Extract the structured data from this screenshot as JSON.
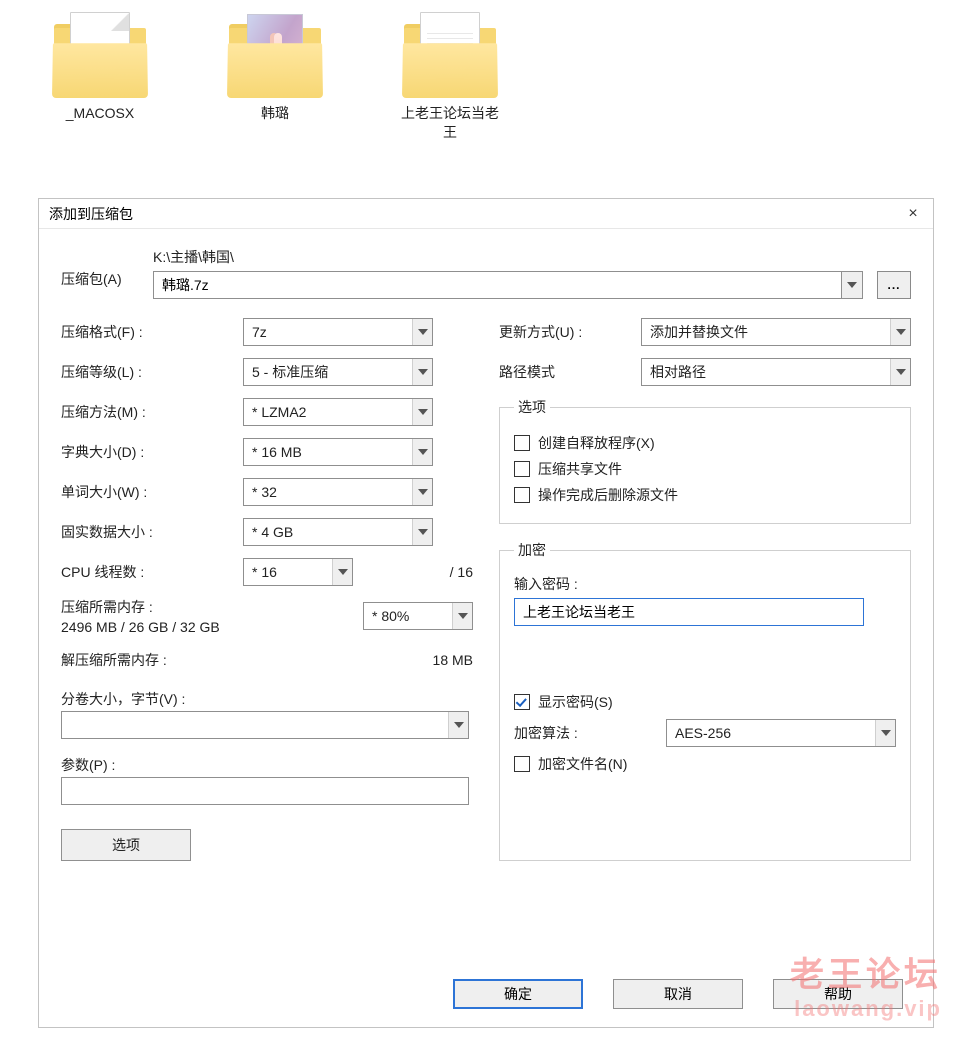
{
  "desktop": {
    "folders": [
      {
        "label": "_MACOSX",
        "thumb": "doc"
      },
      {
        "label": "韩璐",
        "thumb": "photo"
      },
      {
        "label": "上老王论坛当老\n王",
        "thumb": "doc"
      }
    ]
  },
  "dialog": {
    "title": "添加到压缩包",
    "close": "×",
    "archive": {
      "label": "压缩包(A)",
      "path_prefix": "K:\\主播\\韩国\\",
      "filename": "韩璐.7z",
      "browse_label": "..."
    },
    "left": {
      "format": {
        "label": "压缩格式(F) :",
        "hot": "F",
        "value": "7z"
      },
      "level": {
        "label": "压缩等级(L) :",
        "hot": "L",
        "value": "5 - 标准压缩"
      },
      "method": {
        "label": "压缩方法(M) :",
        "hot": "M",
        "value": "* LZMA2"
      },
      "dict": {
        "label": "字典大小(D) :",
        "hot": "D",
        "value": "* 16 MB"
      },
      "word": {
        "label": "单词大小(W) :",
        "hot": "W",
        "value": "* 32"
      },
      "solid": {
        "label": "固实数据大小 :",
        "value": "* 4 GB"
      },
      "cpu": {
        "label": "CPU 线程数 :",
        "value": "* 16",
        "suffix": "/ 16"
      },
      "mem_comp": {
        "label": "压缩所需内存 :",
        "detail": "2496 MB / 26 GB / 32 GB",
        "value": "* 80%"
      },
      "mem_decomp": {
        "label": "解压缩所需内存 :",
        "value": "18 MB"
      },
      "split": {
        "label": "分卷大小，字节(V) :",
        "hot": "V",
        "value": ""
      },
      "params": {
        "label": "参数(P) :",
        "hot": "P",
        "value": ""
      },
      "options_btn": "选项"
    },
    "right": {
      "update": {
        "label": "更新方式(U) :",
        "hot": "U",
        "value": "添加并替换文件"
      },
      "pathmode": {
        "label": "路径模式",
        "value": "相对路径"
      },
      "options_legend": "选项",
      "opt_sfx": {
        "label": "创建自释放程序(X)",
        "hot": "X",
        "checked": false
      },
      "opt_shared": {
        "label": "压缩共享文件",
        "checked": false
      },
      "opt_delsrc": {
        "label": "操作完成后删除源文件",
        "checked": false
      },
      "enc_legend": "加密",
      "pwd_label": "输入密码 :",
      "pwd_value": "上老王论坛当老王",
      "show_pwd": {
        "label": "显示密码(S)",
        "hot": "S",
        "checked": true
      },
      "enc_method": {
        "label": "加密算法 :",
        "value": "AES-256"
      },
      "enc_names": {
        "label": "加密文件名(N)",
        "hot": "N",
        "checked": false
      }
    },
    "footer": {
      "ok": "确定",
      "cancel": "取消",
      "help": "帮助"
    }
  },
  "watermark": {
    "line1": "老王论坛",
    "line2": "laowang.vip"
  }
}
